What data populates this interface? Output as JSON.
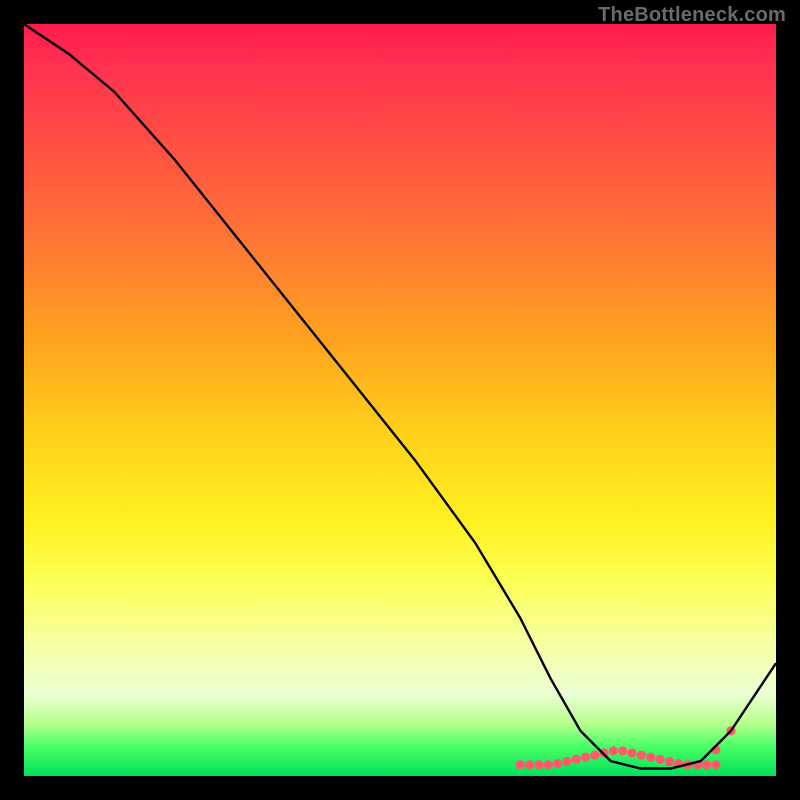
{
  "watermark": "TheBottleneck.com",
  "chart_data": {
    "type": "line",
    "title": "",
    "xlabel": "",
    "ylabel": "",
    "xlim": [
      0,
      100
    ],
    "ylim": [
      0,
      100
    ],
    "series": [
      {
        "name": "curve",
        "x": [
          0,
          6,
          12,
          20,
          28,
          36,
          44,
          52,
          60,
          66,
          70,
          74,
          78,
          82,
          86,
          90,
          94,
          100
        ],
        "y": [
          100,
          96,
          91,
          82,
          72,
          62,
          52,
          42,
          31,
          21,
          13,
          6,
          2,
          1,
          1,
          2,
          6,
          15
        ]
      }
    ],
    "highlight_band": {
      "comment": "red dotted points along valley",
      "x_start": 66,
      "x_end": 92,
      "y": 1.5,
      "dot_count": 22,
      "dot_color": "#ff5a6a"
    },
    "colors": {
      "curve": "#000000",
      "dots": "#ff5a6a"
    }
  }
}
